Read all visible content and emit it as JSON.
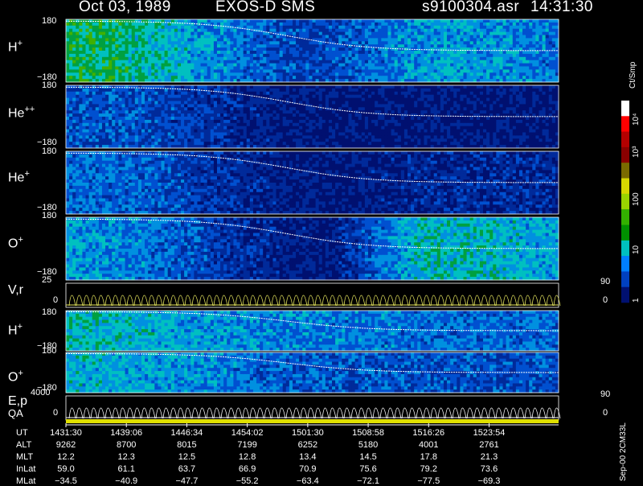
{
  "header": {
    "date": "Oct 03, 1989",
    "instrument": "EXOS-D SMS",
    "file": "s9100304.asr",
    "time": "14:31:30"
  },
  "colorbar": {
    "unit": "Ct/Smp",
    "labels": [
      "10⁴",
      "10³",
      "100",
      "10",
      "1"
    ],
    "colors": [
      "#ffffff",
      "#ff0000",
      "#b40000",
      "#8a0000",
      "#7a6a00",
      "#d7d700",
      "#9ad400",
      "#33b000",
      "#009000",
      "#00bfbf",
      "#007fff",
      "#0040c0",
      "#001070"
    ]
  },
  "panels": [
    {
      "species": "H",
      "charge": "+",
      "ymax": "180",
      "ymin": "−180"
    },
    {
      "species": "He",
      "charge": "++",
      "ymax": "180",
      "ymin": "−180"
    },
    {
      "species": "He",
      "charge": "+",
      "ymax": "180",
      "ymin": "−180"
    },
    {
      "species": "O",
      "charge": "+",
      "ymax": "180",
      "ymin": "−180"
    },
    {
      "species": "V,r",
      "charge": "",
      "ymax": "25",
      "ymin": "0",
      "rmax": "90",
      "rmin": "0"
    },
    {
      "species": "H",
      "charge": "+",
      "ymax": "180",
      "ymin": "−180"
    },
    {
      "species": "O",
      "charge": "+",
      "ymax": "180",
      "ymin": "−180"
    },
    {
      "species": "E,p",
      "charge": "",
      "ymax": "4000",
      "ymin": "0",
      "rmax": "90",
      "rmin": "0"
    }
  ],
  "qa_label": "QA",
  "footnote": "Sep-00 2CM33L",
  "table": {
    "labels": [
      "UT",
      "ALT",
      "MLT",
      "InLat",
      "MLat"
    ],
    "columns": [
      [
        "1431:30",
        "9262",
        "12.2",
        "59.0",
        "−34.5"
      ],
      [
        "1439:06",
        "8700",
        "12.3",
        "61.1",
        "−40.9"
      ],
      [
        "1446:34",
        "8015",
        "12.5",
        "63.7",
        "−47.7"
      ],
      [
        "1454:02",
        "7199",
        "12.8",
        "66.9",
        "−55.2"
      ],
      [
        "1501:30",
        "6252",
        "13.4",
        "70.9",
        "−63.4"
      ],
      [
        "1508:58",
        "5180",
        "14.5",
        "75.6",
        "−72.1"
      ],
      [
        "1516:26",
        "4001",
        "17.8",
        "79.2",
        "−77.5"
      ],
      [
        "1523:54",
        "2761",
        "21.3",
        "73.6",
        "−69.3"
      ]
    ]
  },
  "chart_data": {
    "type": "heatmap",
    "title": "Oct 03, 1989   EXOS-D SMS",
    "xlabel": "UT",
    "x_ticks": [
      "1431:30",
      "1439:06",
      "1446:34",
      "1454:02",
      "1501:30",
      "1508:58",
      "1516:26",
      "1523:54"
    ],
    "colorbar_unit": "Ct/Smp",
    "colorbar_scale": "log",
    "colorbar_range": [
      1,
      10000
    ],
    "series": [
      {
        "name": "H+",
        "ylim": [
          -180,
          180
        ],
        "level_profile": [
          3,
          3,
          2.5,
          2,
          1.5,
          1,
          1,
          1.5,
          2,
          2,
          1.8,
          1.5
        ],
        "trace_range": [
          170,
          0
        ]
      },
      {
        "name": "He++",
        "ylim": [
          -180,
          180
        ],
        "level_profile": [
          1.2,
          1.2,
          1,
          0.8,
          0.4,
          0.2,
          0.1,
          0.1,
          0.1,
          0.1,
          0.1,
          0.1
        ],
        "trace_range": [
          170,
          0
        ]
      },
      {
        "name": "He+",
        "ylim": [
          -180,
          180
        ],
        "level_profile": [
          1.5,
          1.5,
          1.2,
          0.8,
          0.5,
          0.2,
          0.1,
          0.3,
          0.5,
          0.5,
          0.5,
          0.5
        ],
        "trace_range": [
          170,
          0
        ]
      },
      {
        "name": "O+",
        "ylim": [
          -180,
          180
        ],
        "level_profile": [
          2,
          1.8,
          1.5,
          1,
          0.6,
          0.3,
          0.2,
          1.5,
          2.5,
          2.5,
          2.2,
          2
        ],
        "trace_range": [
          170,
          0
        ]
      },
      {
        "name": "V,r",
        "ylim": [
          0,
          25
        ],
        "y2lim": [
          0,
          90
        ]
      },
      {
        "name": "H+",
        "ylim": [
          -180,
          180
        ],
        "level_profile": [
          2.5,
          2.5,
          2.2,
          2,
          1.8,
          1.7,
          1.6,
          1.6,
          1.5,
          1.5,
          1.5,
          1.5
        ],
        "trace_range": [
          170,
          0
        ]
      },
      {
        "name": "O+",
        "ylim": [
          -180,
          180
        ],
        "level_profile": [
          2.2,
          2.2,
          2.0,
          1.8,
          1.5,
          1.3,
          1.2,
          1.2,
          1.1,
          1.1,
          1.1,
          1.1
        ],
        "trace_range": [
          170,
          0
        ]
      },
      {
        "name": "E,p",
        "ylim": [
          0,
          4000
        ],
        "y2lim": [
          0,
          90
        ]
      }
    ]
  }
}
